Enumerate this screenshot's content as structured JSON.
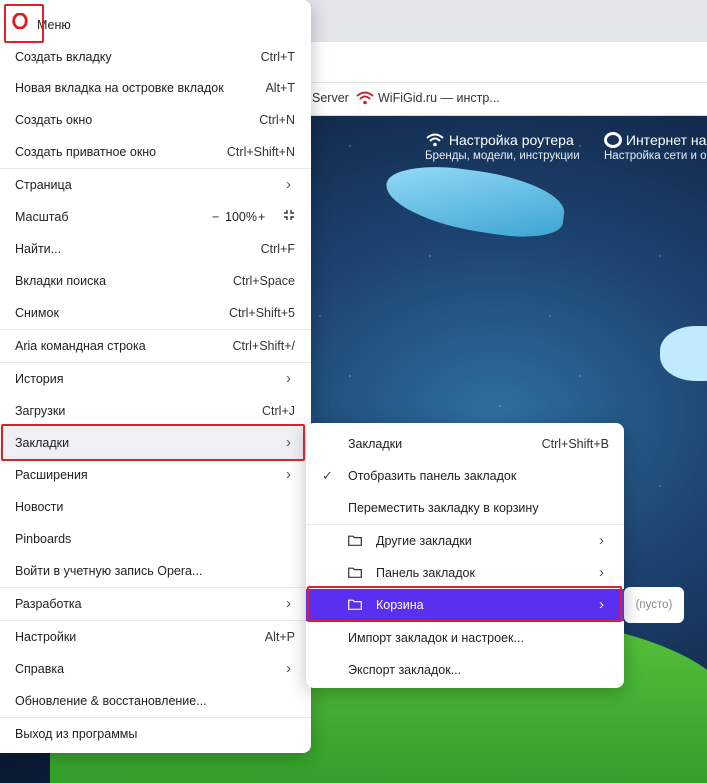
{
  "background": {
    "bookmarks_bar": [
      {
        "label": "Server"
      },
      {
        "label": "WiFiGid.ru — инстр..."
      }
    ],
    "promos": [
      {
        "title": "Настройка роутера",
        "subtitle": "Бренды, модели, инструкции",
        "icon": "wifi-icon"
      },
      {
        "title": "Интернет на",
        "subtitle": "Настройка сети и о",
        "icon": "ie-icon"
      }
    ],
    "empty_tooltip": "(пусто)"
  },
  "menu": {
    "title": "Меню",
    "logo": "opera-logo",
    "items": [
      {
        "label": "Создать вкладку",
        "shortcut": "Ctrl+T"
      },
      {
        "label": "Новая вкладка на островке вкладок",
        "shortcut": "Alt+T"
      },
      {
        "label": "Создать окно",
        "shortcut": "Ctrl+N"
      },
      {
        "label": "Создать приватное окно",
        "shortcut": "Ctrl+Shift+N"
      },
      {
        "label": "Страница",
        "submenu": true
      },
      {
        "label": "Масштаб",
        "zoom": "100%"
      },
      {
        "label": "Найти...",
        "shortcut": "Ctrl+F"
      },
      {
        "label": "Вкладки поиска",
        "shortcut": "Ctrl+Space"
      },
      {
        "label": "Снимок",
        "shortcut": "Ctrl+Shift+5"
      },
      {
        "label": "Aria командная строка",
        "shortcut": "Ctrl+Shift+/"
      },
      {
        "label": "История",
        "submenu": true
      },
      {
        "label": "Загрузки",
        "shortcut": "Ctrl+J"
      },
      {
        "label": "Закладки",
        "submenu": true
      },
      {
        "label": "Расширения",
        "submenu": true
      },
      {
        "label": "Новости"
      },
      {
        "label": "Pinboards"
      },
      {
        "label": "Войти в учетную запись Opera..."
      },
      {
        "label": "Разработка",
        "submenu": true
      },
      {
        "label": "Настройки",
        "shortcut": "Alt+P"
      },
      {
        "label": "Справка",
        "submenu": true
      },
      {
        "label": "Обновление & восстановление..."
      },
      {
        "label": "Выход из программы"
      }
    ]
  },
  "bookmarks_submenu": {
    "items": [
      {
        "label": "Закладки",
        "shortcut": "Ctrl+Shift+B"
      },
      {
        "label": "Отобразить панель закладок",
        "checked": true
      },
      {
        "label": "Переместить закладку в корзину"
      },
      {
        "label": "Другие закладки",
        "folder": true,
        "submenu": true
      },
      {
        "label": "Панель закладок",
        "folder": true,
        "submenu": true
      },
      {
        "label": "Корзина",
        "folder": true,
        "submenu": true,
        "active": true
      },
      {
        "label": "Импорт закладок и настроек..."
      },
      {
        "label": "Экспорт закладок..."
      }
    ]
  },
  "colors": {
    "active_item": "#5b2ff0",
    "highlight_box": "#d8232a",
    "opera_red": "#e0191f"
  }
}
